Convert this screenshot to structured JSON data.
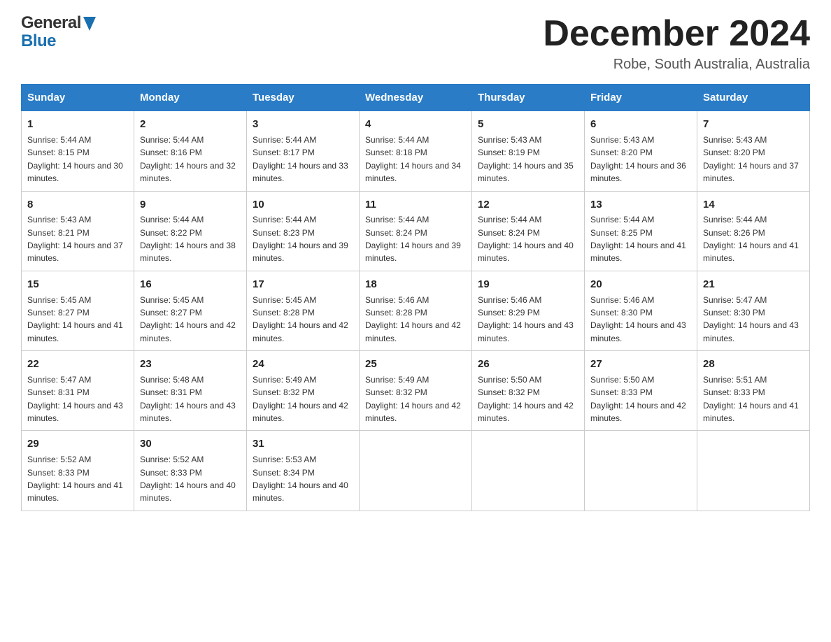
{
  "header": {
    "month_title": "December 2024",
    "location": "Robe, South Australia, Australia",
    "logo_line1": "General",
    "logo_line2": "Blue"
  },
  "weekdays": [
    "Sunday",
    "Monday",
    "Tuesday",
    "Wednesday",
    "Thursday",
    "Friday",
    "Saturday"
  ],
  "weeks": [
    [
      {
        "day": "1",
        "sunrise": "5:44 AM",
        "sunset": "8:15 PM",
        "daylight": "14 hours and 30 minutes."
      },
      {
        "day": "2",
        "sunrise": "5:44 AM",
        "sunset": "8:16 PM",
        "daylight": "14 hours and 32 minutes."
      },
      {
        "day": "3",
        "sunrise": "5:44 AM",
        "sunset": "8:17 PM",
        "daylight": "14 hours and 33 minutes."
      },
      {
        "day": "4",
        "sunrise": "5:44 AM",
        "sunset": "8:18 PM",
        "daylight": "14 hours and 34 minutes."
      },
      {
        "day": "5",
        "sunrise": "5:43 AM",
        "sunset": "8:19 PM",
        "daylight": "14 hours and 35 minutes."
      },
      {
        "day": "6",
        "sunrise": "5:43 AM",
        "sunset": "8:20 PM",
        "daylight": "14 hours and 36 minutes."
      },
      {
        "day": "7",
        "sunrise": "5:43 AM",
        "sunset": "8:20 PM",
        "daylight": "14 hours and 37 minutes."
      }
    ],
    [
      {
        "day": "8",
        "sunrise": "5:43 AM",
        "sunset": "8:21 PM",
        "daylight": "14 hours and 37 minutes."
      },
      {
        "day": "9",
        "sunrise": "5:44 AM",
        "sunset": "8:22 PM",
        "daylight": "14 hours and 38 minutes."
      },
      {
        "day": "10",
        "sunrise": "5:44 AM",
        "sunset": "8:23 PM",
        "daylight": "14 hours and 39 minutes."
      },
      {
        "day": "11",
        "sunrise": "5:44 AM",
        "sunset": "8:24 PM",
        "daylight": "14 hours and 39 minutes."
      },
      {
        "day": "12",
        "sunrise": "5:44 AM",
        "sunset": "8:24 PM",
        "daylight": "14 hours and 40 minutes."
      },
      {
        "day": "13",
        "sunrise": "5:44 AM",
        "sunset": "8:25 PM",
        "daylight": "14 hours and 41 minutes."
      },
      {
        "day": "14",
        "sunrise": "5:44 AM",
        "sunset": "8:26 PM",
        "daylight": "14 hours and 41 minutes."
      }
    ],
    [
      {
        "day": "15",
        "sunrise": "5:45 AM",
        "sunset": "8:27 PM",
        "daylight": "14 hours and 41 minutes."
      },
      {
        "day": "16",
        "sunrise": "5:45 AM",
        "sunset": "8:27 PM",
        "daylight": "14 hours and 42 minutes."
      },
      {
        "day": "17",
        "sunrise": "5:45 AM",
        "sunset": "8:28 PM",
        "daylight": "14 hours and 42 minutes."
      },
      {
        "day": "18",
        "sunrise": "5:46 AM",
        "sunset": "8:28 PM",
        "daylight": "14 hours and 42 minutes."
      },
      {
        "day": "19",
        "sunrise": "5:46 AM",
        "sunset": "8:29 PM",
        "daylight": "14 hours and 43 minutes."
      },
      {
        "day": "20",
        "sunrise": "5:46 AM",
        "sunset": "8:30 PM",
        "daylight": "14 hours and 43 minutes."
      },
      {
        "day": "21",
        "sunrise": "5:47 AM",
        "sunset": "8:30 PM",
        "daylight": "14 hours and 43 minutes."
      }
    ],
    [
      {
        "day": "22",
        "sunrise": "5:47 AM",
        "sunset": "8:31 PM",
        "daylight": "14 hours and 43 minutes."
      },
      {
        "day": "23",
        "sunrise": "5:48 AM",
        "sunset": "8:31 PM",
        "daylight": "14 hours and 43 minutes."
      },
      {
        "day": "24",
        "sunrise": "5:49 AM",
        "sunset": "8:32 PM",
        "daylight": "14 hours and 42 minutes."
      },
      {
        "day": "25",
        "sunrise": "5:49 AM",
        "sunset": "8:32 PM",
        "daylight": "14 hours and 42 minutes."
      },
      {
        "day": "26",
        "sunrise": "5:50 AM",
        "sunset": "8:32 PM",
        "daylight": "14 hours and 42 minutes."
      },
      {
        "day": "27",
        "sunrise": "5:50 AM",
        "sunset": "8:33 PM",
        "daylight": "14 hours and 42 minutes."
      },
      {
        "day": "28",
        "sunrise": "5:51 AM",
        "sunset": "8:33 PM",
        "daylight": "14 hours and 41 minutes."
      }
    ],
    [
      {
        "day": "29",
        "sunrise": "5:52 AM",
        "sunset": "8:33 PM",
        "daylight": "14 hours and 41 minutes."
      },
      {
        "day": "30",
        "sunrise": "5:52 AM",
        "sunset": "8:33 PM",
        "daylight": "14 hours and 40 minutes."
      },
      {
        "day": "31",
        "sunrise": "5:53 AM",
        "sunset": "8:34 PM",
        "daylight": "14 hours and 40 minutes."
      },
      null,
      null,
      null,
      null
    ]
  ]
}
